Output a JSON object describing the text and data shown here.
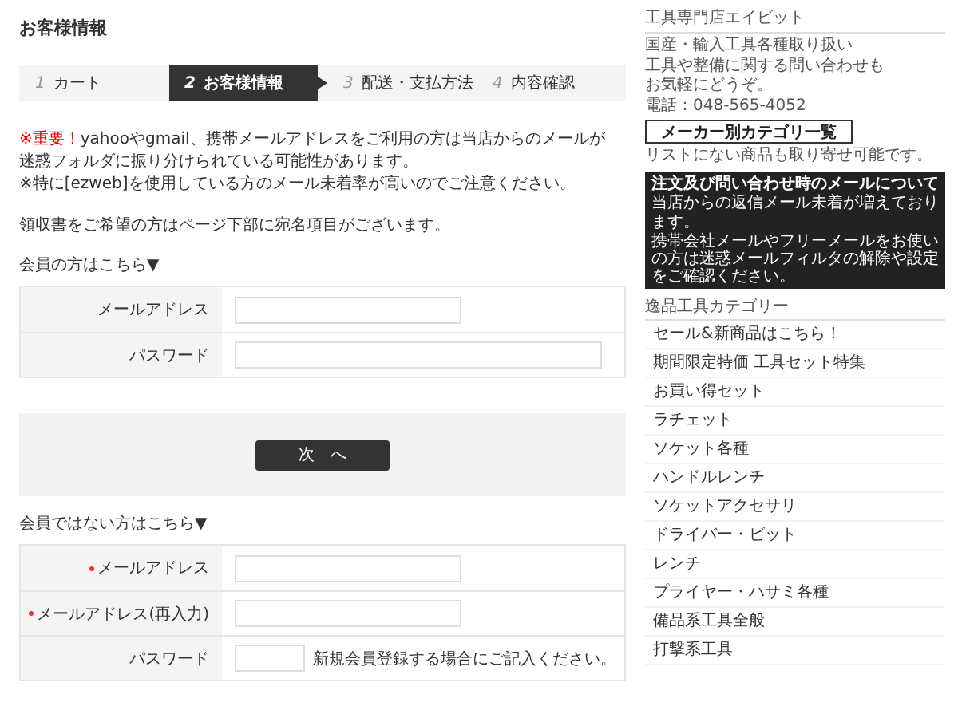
{
  "page_title": "お客様情報",
  "steps": [
    {
      "number": "1",
      "label": "カート",
      "selected": false
    },
    {
      "number": "2",
      "label": "お客様情報",
      "selected": true
    },
    {
      "number": "3",
      "label": "配送・支払方法",
      "selected": false
    },
    {
      "number": "4",
      "label": "内容確認",
      "selected": false
    }
  ],
  "notice": {
    "alert": "※重要！",
    "lines": [
      "yahooやgmail、携帯メールアドレスをご利用の方は当店からのメールが",
      "迷惑フォルダに振り分けられている可能性があります。",
      "※特に[ezweb]を使用している方のメール未着率が高いのでご注意ください。"
    ],
    "receipt": "領収書をご希望の方はページ下部に宛名項目がございます。"
  },
  "member_section": {
    "heading": "会員の方はこちら▼",
    "fields": [
      {
        "label": "メールアドレス",
        "required": false,
        "kind": "medium"
      },
      {
        "label": "パスワード",
        "required": false,
        "kind": "wide"
      }
    ]
  },
  "next_button": "次　へ",
  "guest_section": {
    "heading": "会員ではない方はこちら▼",
    "fields": [
      {
        "label": "メールアドレス",
        "required": true,
        "kind": "medium"
      },
      {
        "label": "メールアドレス(再入力)",
        "required": true,
        "kind": "medium"
      },
      {
        "label": "パスワード",
        "required": false,
        "kind": "short",
        "hint": "新規会員登録する場合にご記入ください。"
      }
    ]
  },
  "sidebar": {
    "shop_title": "工具専門店エイビット",
    "intro_lines": [
      "国産・輸入工具各種取り扱い",
      "工具や整備に関する問い合わせも",
      "お気軽にどうぞ。",
      "電話：048-565-4052"
    ],
    "maker_button": "メーカー別カテゴリ一覧",
    "order_note": "リストにない商品も取り寄せ可能です。",
    "mail_notice": {
      "title": "注文及び問い合わせ時のメールについて",
      "subtitle": "当店からの返信メール未着が増えております。",
      "body": "携帯会社メールやフリーメールをお使いの方は迷惑メールフィルタの解除や設定をご確認ください。"
    },
    "category_heading": "逸品工具カテゴリー",
    "categories": [
      "セール&新商品はこちら！",
      "期間限定特価 工具セット特集",
      "お買い得セット",
      "ラチェット",
      "ソケット各種",
      "ハンドルレンチ",
      "ソケットアクセサリ",
      "ドライバー・ビット",
      "レンチ",
      "プライヤー・ハサミ各種",
      "備品系工具全般",
      "打撃系工具"
    ]
  }
}
